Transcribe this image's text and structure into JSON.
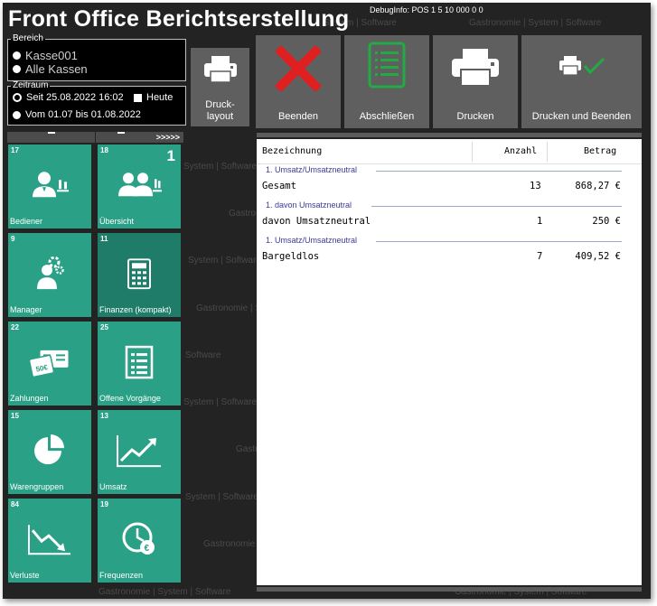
{
  "app_title": "Front Office Berichtserstellung",
  "debug_info": "DebugInfo: POS 1 5 10 000 0 0",
  "watermark": {
    "text_a": "System | Software",
    "text_b": "Gastronomie | System | Software",
    "text_c": "Gastronomie | S",
    "text_d": "Gastro",
    "text_e": "Software",
    "text_f": "System",
    "text_g": "Gastronomie",
    "text_h": "Gastronomie | System | Software"
  },
  "bereich": {
    "legend": "Bereich",
    "options": [
      {
        "label": "Kasse001",
        "selected": false
      },
      {
        "label": "Alle Kassen",
        "selected": false
      }
    ]
  },
  "zeitraum": {
    "legend": "Zeitraum",
    "seit_label": "Seit 25.08.2022 16:02",
    "heute_label": "Heute",
    "vom_label": "Vom 01.07 bis 01.08.2022"
  },
  "toolbar": {
    "drucklayout": "Druck-\nlayout",
    "beenden": "Beenden",
    "abschliessen": "Abschließen",
    "drucken": "Drucken",
    "drucken_beenden": "Drucken und Beenden"
  },
  "grid_header": {
    "left": "",
    "right": ">>>>>"
  },
  "tiles": [
    {
      "num": "17",
      "label": "Bediener",
      "badge": "",
      "icon": "waiter-icon"
    },
    {
      "num": "18",
      "label": "Übersicht",
      "badge": "1",
      "icon": "group-icon"
    },
    {
      "num": "9",
      "label": "Manager",
      "badge": "",
      "icon": "manager-icon"
    },
    {
      "num": "11",
      "label": "Finanzen (kompakt)",
      "badge": "",
      "icon": "calculator-icon"
    },
    {
      "num": "22",
      "label": "Zahlungen",
      "badge": "",
      "icon": "payment-cards-icon"
    },
    {
      "num": "25",
      "label": "Offene Vorgänge",
      "badge": "",
      "icon": "list-document-icon"
    },
    {
      "num": "15",
      "label": "Warengruppen",
      "badge": "",
      "icon": "pie-chart-icon"
    },
    {
      "num": "13",
      "label": "Umsatz",
      "badge": "",
      "icon": "trend-up-icon"
    },
    {
      "num": "84",
      "label": "Verluste",
      "badge": "",
      "icon": "trend-down-icon"
    },
    {
      "num": "19",
      "label": "Frequenzen",
      "badge": "",
      "icon": "clock-euro-icon"
    }
  ],
  "report": {
    "columns": [
      "Bezeichnung",
      "Anzahl",
      "Betrag"
    ],
    "groups": [
      {
        "title": "1. Umsatz/Umsatzneutral",
        "row": {
          "name": "Gesamt",
          "anzahl": "13",
          "betrag": "868,27 €"
        }
      },
      {
        "title": "1. davon Umsatzneutral",
        "row": {
          "name": "davon Umsatzneutral",
          "anzahl": "1",
          "betrag": "250 €"
        }
      },
      {
        "title": "1. Umsatz/Umsatzneutral",
        "row": {
          "name": "Bargeldlos",
          "anzahl": "7",
          "betrag": "409,52 €"
        }
      }
    ]
  },
  "colors": {
    "tile": "#2aa086",
    "tile_dark": "#1f7c69",
    "toolbar": "#5f5f5f",
    "cancel": "#e02020",
    "ok": "#22aa44"
  }
}
